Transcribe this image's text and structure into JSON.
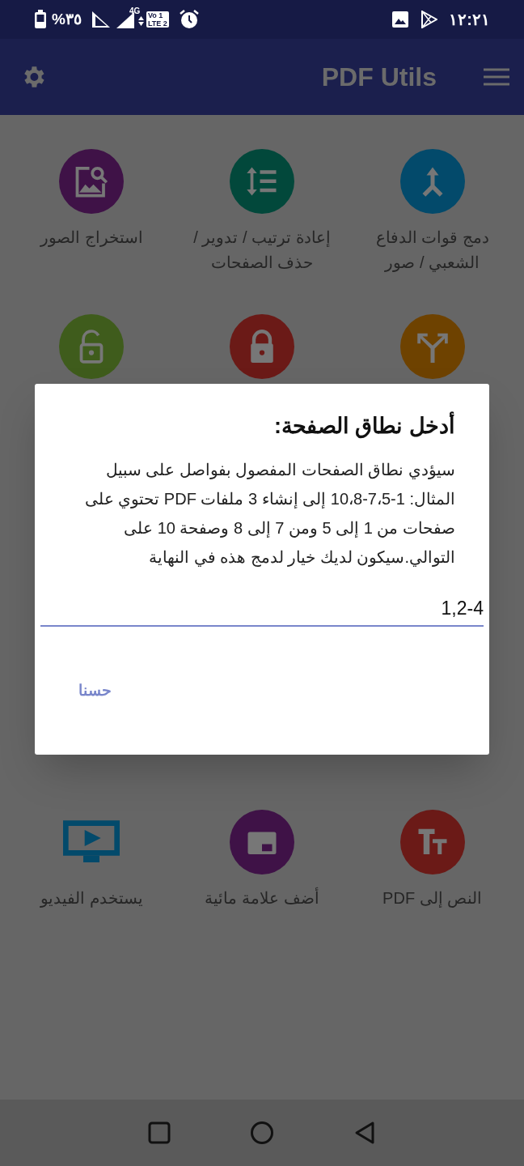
{
  "status_bar": {
    "battery": "%٣٥",
    "network": "4G",
    "volte_line_1": "Vo 1",
    "volte_line_2": "LTE 2",
    "time": "١٢:٢١"
  },
  "app_bar": {
    "title": "PDF Utils"
  },
  "tiles": [
    {
      "kind": "circle",
      "color": "#034a6b",
      "label": "دمج قوات الدفاع الشعبي / صور"
    },
    {
      "kind": "circle",
      "color": "#02483b",
      "label": "إعادة ترتيب / تدوير / حذف الصفحات"
    },
    {
      "kind": "circle",
      "color": "#3f1247",
      "label": "استخراج الصور"
    },
    {
      "kind": "circle",
      "color": "#6e4200"
    },
    {
      "kind": "circle",
      "color": "#6b1a17"
    },
    {
      "kind": "circle",
      "color": "#3f5c1c"
    },
    {
      "kind": "circle",
      "color": "#6b1a17",
      "label": "النص إلى PDF"
    },
    {
      "kind": "circle",
      "color": "#3f1247",
      "label": "أضف علامة مائية"
    },
    {
      "kind": "plain",
      "color": "#034a6b",
      "label": "يستخدم الفيديو"
    }
  ],
  "dialog": {
    "title": "أدخل نطاق الصفحة:",
    "message": "سيؤدي نطاق الصفحات المفصول بفواصل على سبيل المثال: 1-7،5-10،8 إلى إنشاء 3 ملفات PDF تحتوي على صفحات من 1 إلى 5 ومن 7 إلى 8 وصفحة 10 على التوالي.سيكون لديك خيار لدمج هذه في النهاية",
    "input_value": "1,2-4",
    "button": "حسنا"
  }
}
